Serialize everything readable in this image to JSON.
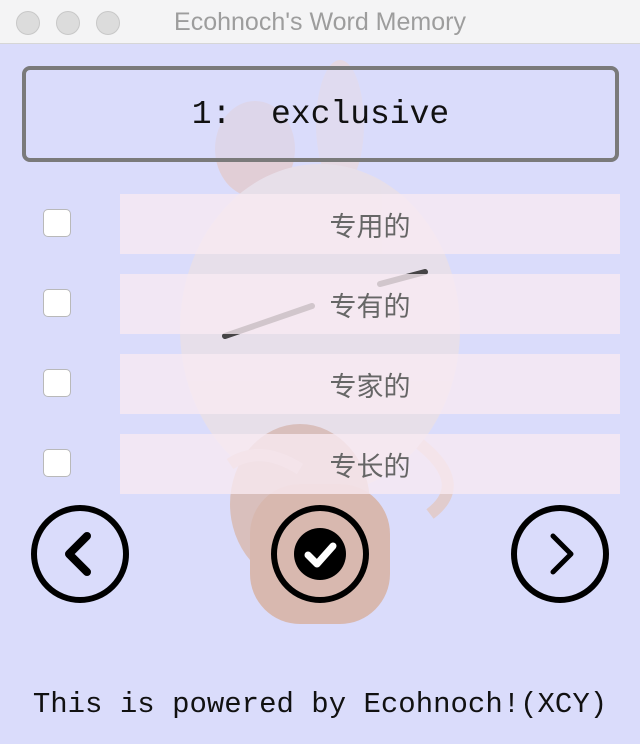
{
  "window": {
    "title": "Ecohnoch's Word Memory"
  },
  "question": {
    "number": "1:",
    "word": "exclusive",
    "display": "1:  exclusive"
  },
  "options": [
    {
      "label": "专用的",
      "checked": false
    },
    {
      "label": "专有的",
      "checked": false
    },
    {
      "label": "专家的",
      "checked": false
    },
    {
      "label": "专长的",
      "checked": false
    }
  ],
  "controls": {
    "prev_icon": "chevron-left-icon",
    "submit_icon": "check-circle-icon",
    "next_icon": "chevron-right-icon"
  },
  "footer": {
    "text": "This is powered by Ecohnoch!(XCY)"
  },
  "colors": {
    "background": "#dadcfb",
    "option_background": "#f8eaf2",
    "border": "#7a7a7a",
    "icon": "#000000"
  }
}
